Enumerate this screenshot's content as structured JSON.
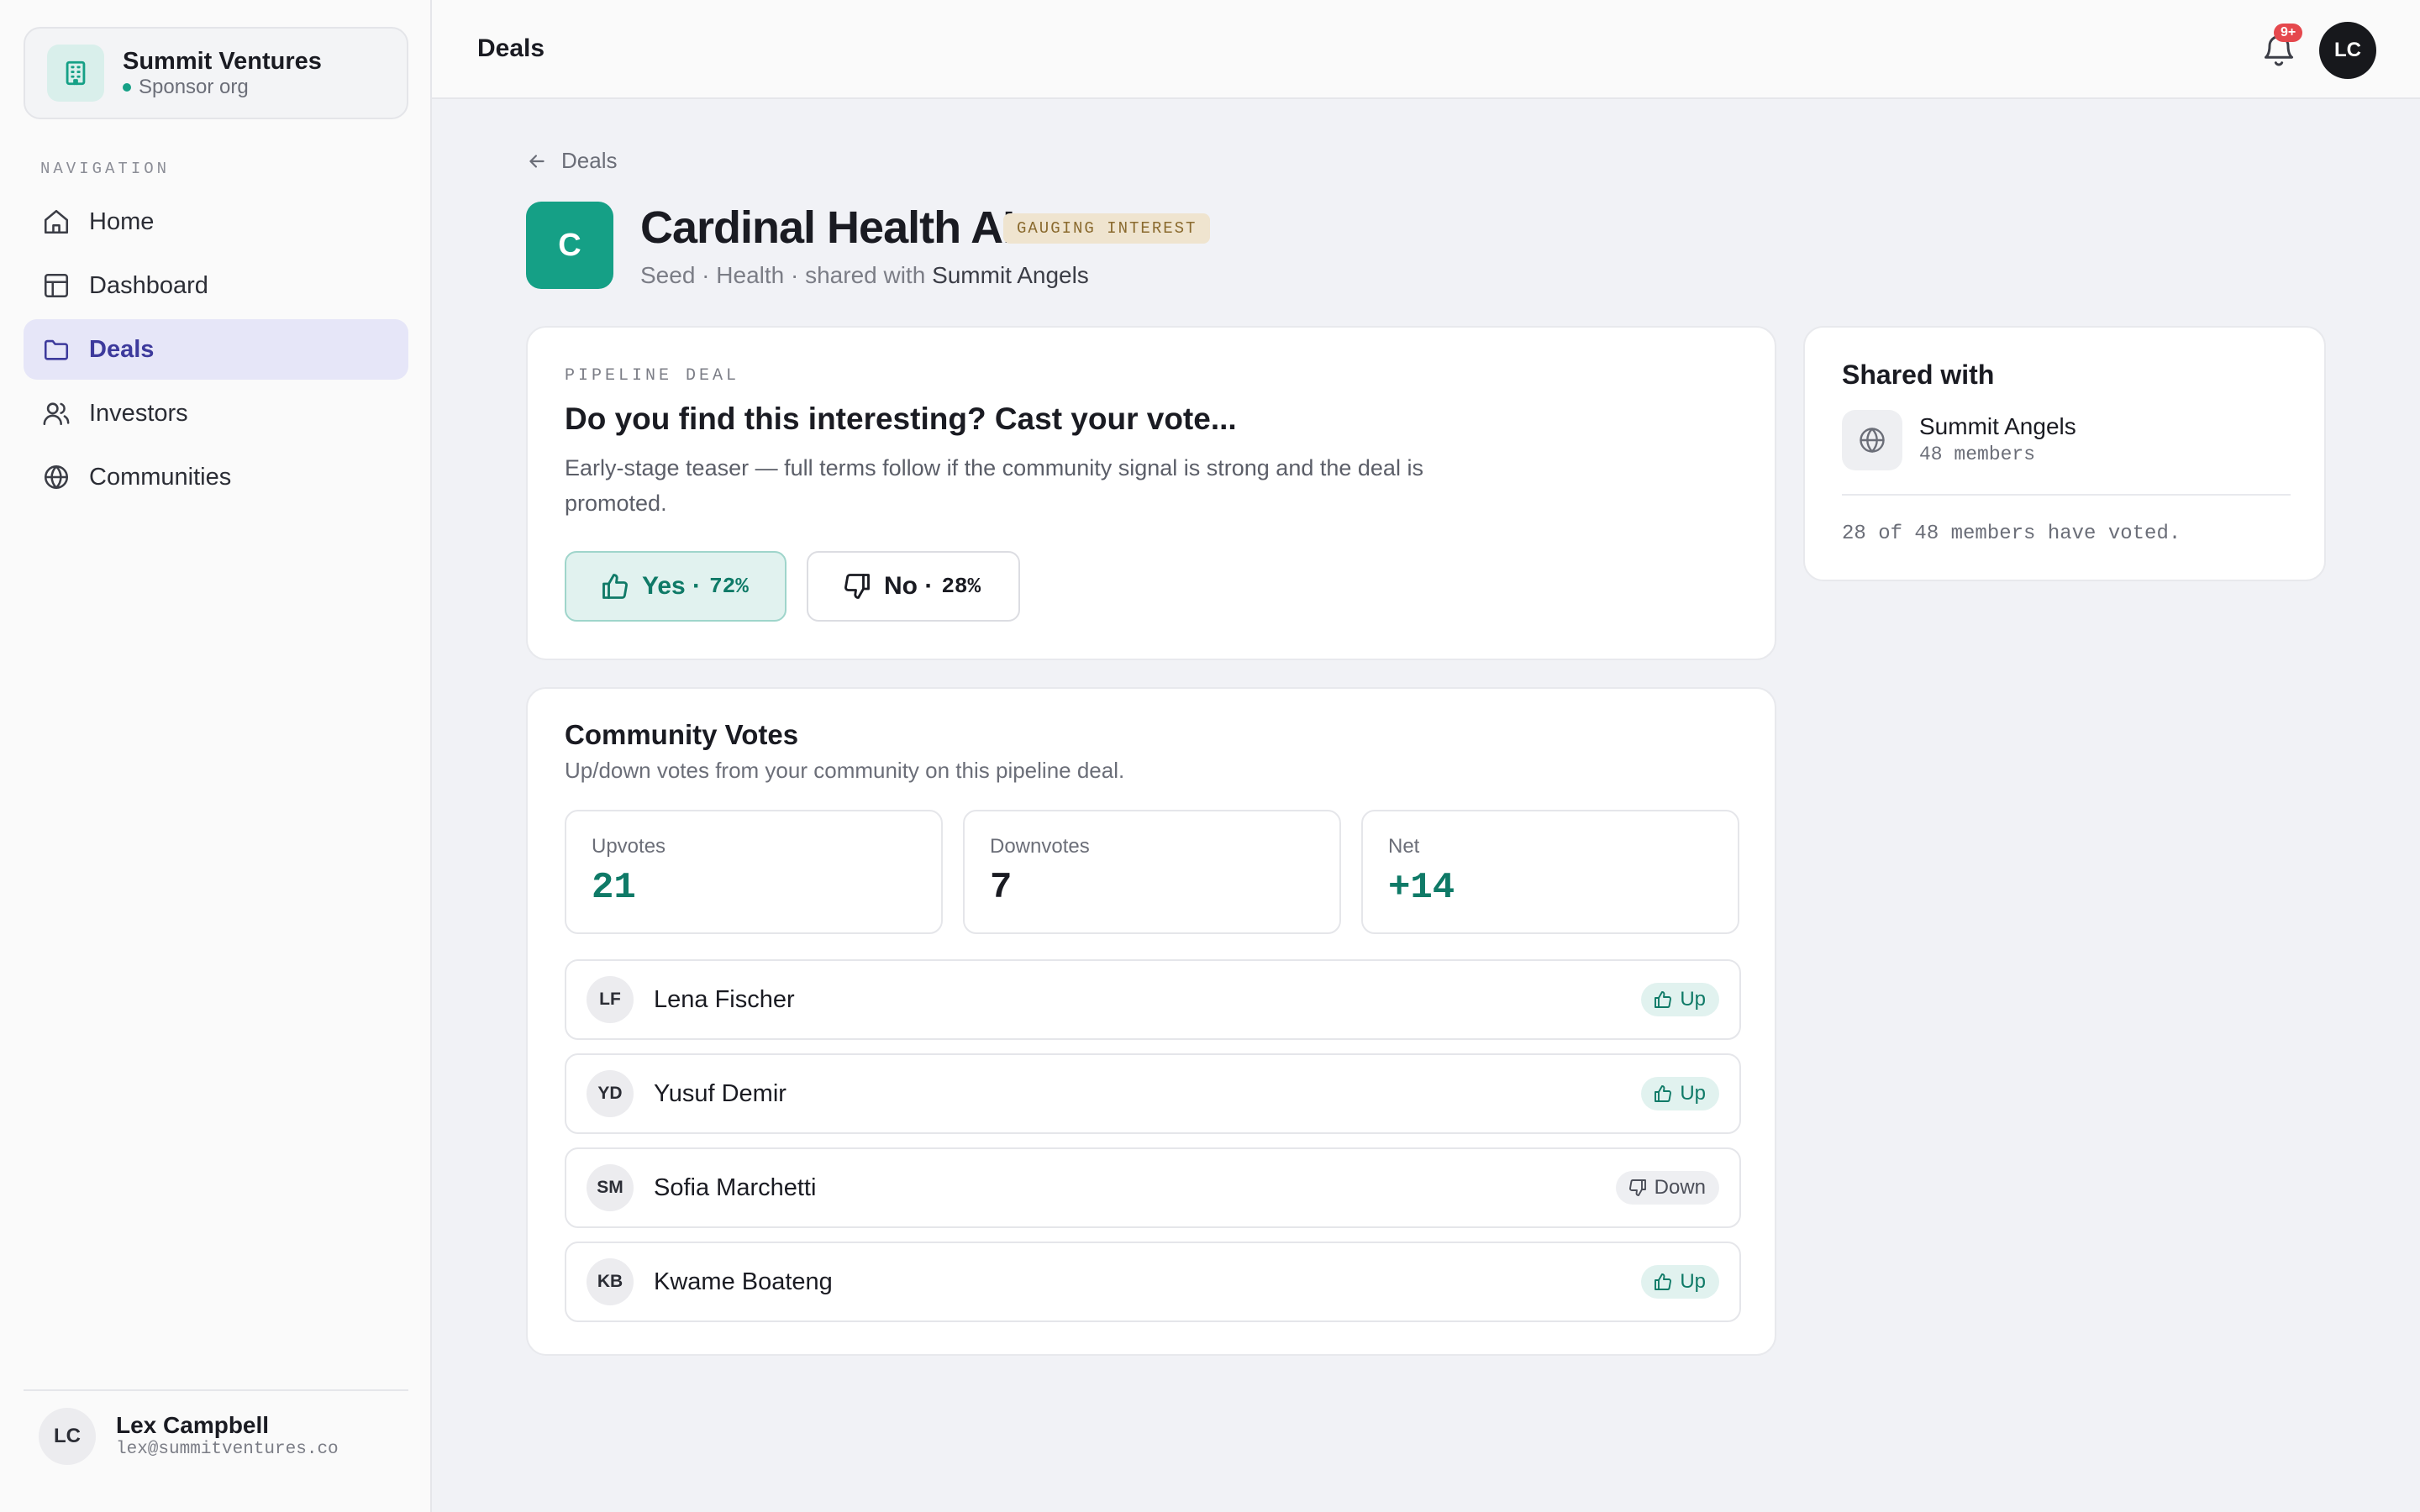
{
  "sidebar": {
    "org_name": "Summit Ventures",
    "org_type": "Sponsor org",
    "nav_heading": "NAVIGATION",
    "items": [
      {
        "label": "Home",
        "icon": "home-icon"
      },
      {
        "label": "Dashboard",
        "icon": "layout-icon"
      },
      {
        "label": "Deals",
        "icon": "folder-icon",
        "active": true
      },
      {
        "label": "Investors",
        "icon": "users-icon"
      },
      {
        "label": "Communities",
        "icon": "globe-icon"
      }
    ],
    "user": {
      "initials": "LC",
      "name": "Lex Campbell",
      "email": "lex@summitventures.co"
    }
  },
  "topbar": {
    "title": "Deals",
    "notification_badge": "9+",
    "avatar_initials": "LC"
  },
  "deal": {
    "back_label": "Deals",
    "logo_letter": "C",
    "name": "Cardinal Health AI",
    "status": "GAUGING INTEREST",
    "meta_prefix": "Seed · Health · shared with ",
    "meta_community": "Summit Angels"
  },
  "vote": {
    "eyebrow": "PIPELINE DEAL",
    "question": "Do you find this interesting? Cast your vote...",
    "description": "Early-stage teaser — full terms follow if the community signal is strong and the deal is promoted.",
    "yes_label": "Yes ·",
    "yes_pct": "72%",
    "no_label": "No ·",
    "no_pct": "28%"
  },
  "community_votes": {
    "title": "Community Votes",
    "subtitle": "Up/down votes from your community on this pipeline deal.",
    "stats": [
      {
        "label": "Upvotes",
        "value": "21"
      },
      {
        "label": "Downvotes",
        "value": "7"
      },
      {
        "label": "Net",
        "value": "+14"
      }
    ],
    "voters": [
      {
        "initials": "LF",
        "name": "Lena Fischer",
        "vote": "Up"
      },
      {
        "initials": "YD",
        "name": "Yusuf Demir",
        "vote": "Up"
      },
      {
        "initials": "SM",
        "name": "Sofia Marchetti",
        "vote": "Down"
      },
      {
        "initials": "KB",
        "name": "Kwame Boateng",
        "vote": "Up"
      }
    ]
  },
  "shared": {
    "title": "Shared with",
    "community_name": "Summit Angels",
    "members": "48 members",
    "voted_text": "28 of 48 members have voted."
  },
  "colors": {
    "accent": "#15a086",
    "accent_text": "#0f7a67",
    "nav_active_bg": "#e6e6f8",
    "nav_active_text": "#3d3a9c",
    "badge_red": "#e5484d",
    "status_badge_bg": "#efe4cf"
  }
}
